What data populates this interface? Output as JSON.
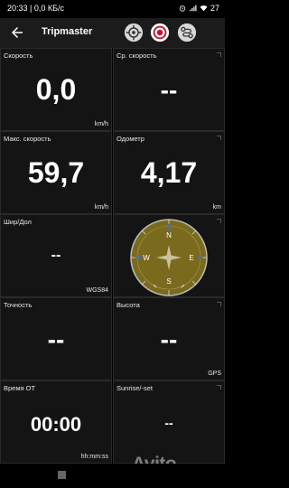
{
  "status": {
    "time_and_info": "20:33 | 0,0 КБ/с",
    "battery": "27"
  },
  "appbar": {
    "title": "Tripmaster",
    "back_icon": "arrow-left-icon",
    "icons": [
      "crosshair-gps-icon",
      "record-target-icon",
      "route-icon"
    ]
  },
  "tiles": {
    "speed": {
      "label": "Скорость",
      "value": "0,0",
      "unit": "km/h"
    },
    "avg_speed": {
      "label": "Ср. скорость",
      "value": "--",
      "unit": ""
    },
    "max_speed": {
      "label": "Макс. скорость",
      "value": "59,7",
      "unit": "km/h"
    },
    "odometer": {
      "label": "Одометр",
      "value": "4,17",
      "unit": "km"
    },
    "latlon": {
      "label": "Шир/Дол",
      "value": "--",
      "unit": "WGS84"
    },
    "compass": {
      "letters": {
        "n": "N",
        "e": "E",
        "s": "S",
        "w": "W"
      },
      "color": "#7a6a1e"
    },
    "accuracy": {
      "label": "Точность",
      "value": "--",
      "unit": ""
    },
    "altitude": {
      "label": "Высота",
      "value": "--",
      "unit": "GPS"
    },
    "time": {
      "label": "Время ОТ",
      "value": "00:00",
      "unit": "hh:mm:ss"
    },
    "sunrise": {
      "label": "Sunrise/-set",
      "value": "--",
      "unit": ""
    }
  },
  "watermark": "Avito"
}
